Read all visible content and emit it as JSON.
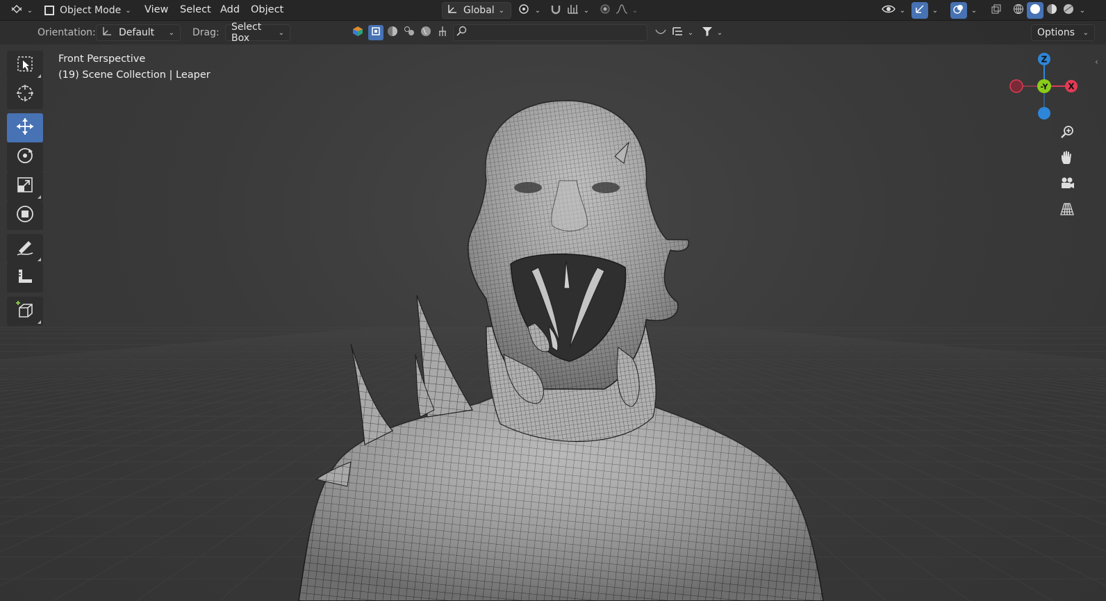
{
  "header": {
    "editor_type_icon": "view3d-editor-icon",
    "mode": "Object Mode",
    "menus": [
      "View",
      "Select",
      "Add",
      "Object"
    ],
    "transform_orientation": "Global",
    "right_icons": [
      "visibility-icon",
      "gizmo-icon",
      "overlay-icon",
      "xray-icon",
      "wireframe-shading-icon",
      "solid-shading-icon",
      "material-shading-icon",
      "rendered-shading-icon"
    ]
  },
  "toolsettings": {
    "orientation_label": "Orientation:",
    "orientation_value": "Default",
    "drag_label": "Drag:",
    "drag_value": "Select Box",
    "options_label": "Options",
    "search_placeholder": ""
  },
  "viewport": {
    "view_name": "Front Perspective",
    "collection_info": "(19) Scene Collection | Leaper",
    "model_name": "Leaper"
  },
  "toolbar": {
    "tools": [
      {
        "name": "select-box-tool",
        "icon": "select-box-icon",
        "active": false
      },
      {
        "name": "cursor-tool",
        "icon": "cursor-icon",
        "active": false
      },
      {
        "name": "move-tool",
        "icon": "move-icon",
        "active": true
      },
      {
        "name": "rotate-tool",
        "icon": "rotate-icon",
        "active": false
      },
      {
        "name": "scale-tool",
        "icon": "scale-icon",
        "active": false
      },
      {
        "name": "transform-tool",
        "icon": "transform-icon",
        "active": false
      },
      {
        "name": "annotate-tool",
        "icon": "annotate-icon",
        "active": false
      },
      {
        "name": "measure-tool",
        "icon": "measure-icon",
        "active": false
      },
      {
        "name": "add-cube-tool",
        "icon": "add-cube-icon",
        "active": false
      }
    ]
  },
  "gizmo": {
    "axis_z": "Z",
    "axis_y": "-Y",
    "axis_x": "X",
    "colors": {
      "x": "#e23b55",
      "y": "#8bcc1a",
      "z": "#2e86d8"
    }
  },
  "navigation": [
    "zoom-icon",
    "pan-hand-icon",
    "camera-icon",
    "perspective-grid-icon"
  ],
  "colors": {
    "accent": "#4772b3",
    "header_bg": "#262626",
    "viewport_bg": "#3d3d3d"
  }
}
